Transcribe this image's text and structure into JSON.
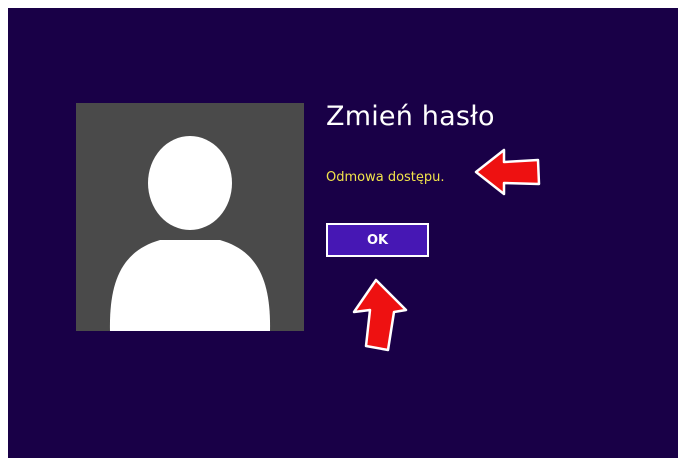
{
  "dialog": {
    "title": "Zmień hasło",
    "message": "Odmowa dostępu.",
    "ok_label": "OK"
  },
  "icons": {
    "avatar": "user-silhouette-icon",
    "annotation_arrows": "red-arrow-icon"
  },
  "colors": {
    "background": "#190047",
    "message_text": "#f1e34a",
    "button_fill": "#4617b4",
    "button_border": "#ffffff",
    "avatar_tile": "#4a4a4a",
    "arrow": "#ee1111"
  }
}
